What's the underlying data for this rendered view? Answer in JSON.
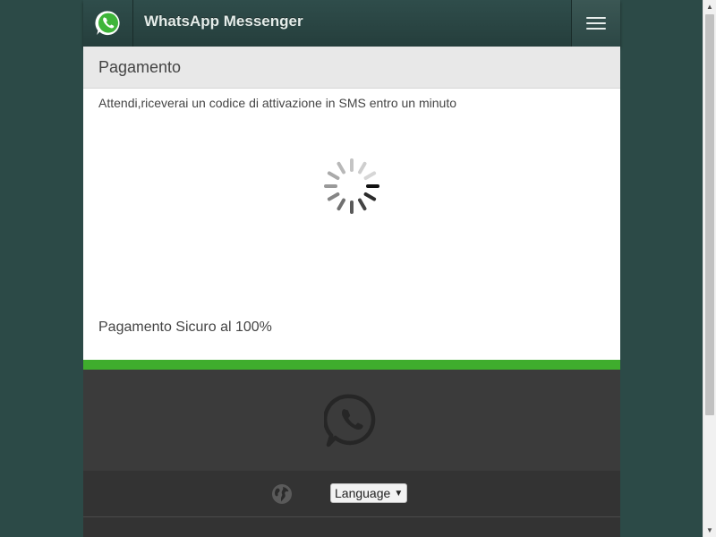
{
  "header": {
    "title": "WhatsApp Messenger",
    "logo_icon": "whatsapp-logo-icon",
    "menu_icon": "hamburger-menu-icon"
  },
  "subheader": {
    "title": "Pagamento"
  },
  "content": {
    "message": "Attendi,riceverai un codice di attivazione in SMS entro un minuto",
    "loading_icon": "loading-spinner-icon",
    "secure_text": "Pagamento Sicuro al 100%"
  },
  "footer": {
    "logo_icon": "whatsapp-logo-icon",
    "globe_icon": "globe-icon",
    "language_select": {
      "selected": "Language",
      "arrow": "▼"
    }
  },
  "colors": {
    "header_bg": "#2f4d4b",
    "page_bg": "#2c4a47",
    "accent_green": "#3fad2d",
    "footer_bg": "#3b3b3b"
  }
}
